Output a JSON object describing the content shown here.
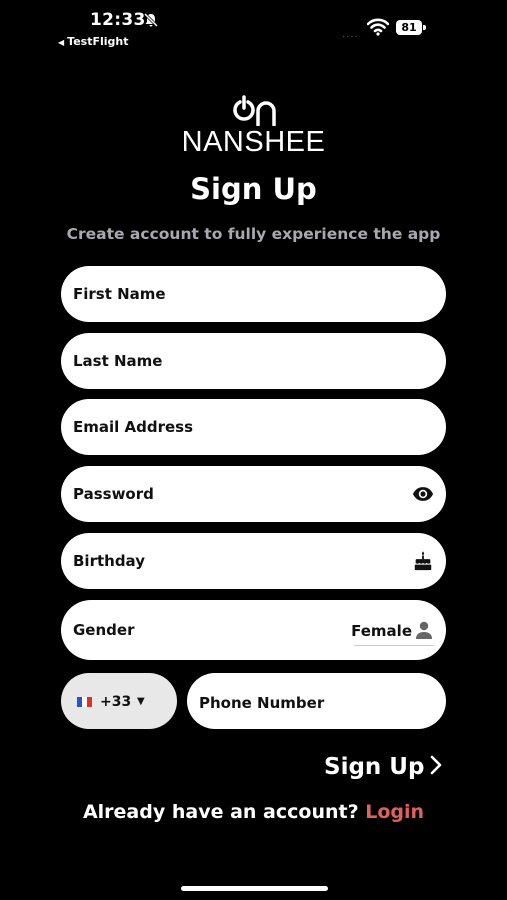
{
  "status_bar": {
    "time": "12:33",
    "back_app": "TestFlight",
    "signal": "····",
    "battery": "81"
  },
  "brand": {
    "mark": "on",
    "name": "NANSHEE"
  },
  "header": {
    "title": "Sign Up",
    "subtitle": "Create account to fully experience the app"
  },
  "form": {
    "first_name": "First Name",
    "last_name": "Last Name",
    "email": "Email Address",
    "password": "Password",
    "birthday": "Birthday",
    "gender_label": "Gender",
    "gender_value": "Female",
    "country_code": "+33",
    "country_flag": "france-flag-icon",
    "phone": "Phone Number"
  },
  "actions": {
    "submit": "Sign Up",
    "login_prompt": "Already have an account?",
    "login_link": "Login"
  },
  "icons": {
    "password": "eye-icon",
    "birthday": "cake-icon",
    "gender": "person-icon"
  },
  "colors": {
    "background": "#000000",
    "field": "#ffffff",
    "country_code_field": "#e8e8e8",
    "accent": "#e0615b",
    "subtitle": "#a8a8b0"
  }
}
